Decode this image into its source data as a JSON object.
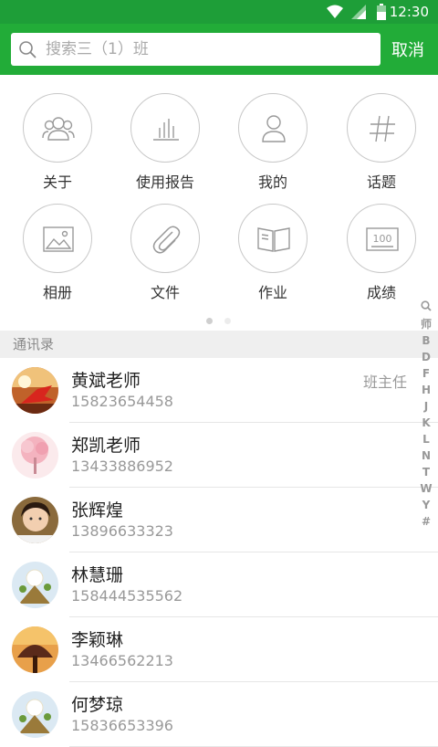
{
  "statusbar": {
    "time": "12:30"
  },
  "search": {
    "placeholder": "搜索三（1）班",
    "cancel_label": "取消"
  },
  "grid": {
    "items": [
      {
        "label": "关于",
        "icon": "group-icon"
      },
      {
        "label": "使用报告",
        "icon": "bar-chart-icon"
      },
      {
        "label": "我的",
        "icon": "person-icon"
      },
      {
        "label": "话题",
        "icon": "hash-icon"
      },
      {
        "label": "相册",
        "icon": "image-icon"
      },
      {
        "label": "文件",
        "icon": "paperclip-icon"
      },
      {
        "label": "作业",
        "icon": "book-icon"
      },
      {
        "label": "成绩",
        "icon": "score-board-icon"
      }
    ],
    "page_dots": {
      "count": 2,
      "active": 0
    }
  },
  "contacts": {
    "section_title": "通讯录",
    "items": [
      {
        "name": "黄斌老师",
        "phone": "15823654458",
        "role": "班主任",
        "avatar": "sunset-leaf"
      },
      {
        "name": "郑凯老师",
        "phone": "13433886952",
        "role": "",
        "avatar": "pink-tree"
      },
      {
        "name": "张辉煌",
        "phone": "13896633323",
        "role": "",
        "avatar": "child-photo"
      },
      {
        "name": "林慧珊",
        "phone": "158444535562",
        "role": "",
        "avatar": "dandelion"
      },
      {
        "name": "李颖琳",
        "phone": "13466562213",
        "role": "",
        "avatar": "tree-sunset"
      },
      {
        "name": "何梦琼",
        "phone": "15836653396",
        "role": "",
        "avatar": "dandelion"
      }
    ]
  },
  "index_bar": [
    "师",
    "B",
    "D",
    "F",
    "H",
    "J",
    "K",
    "L",
    "N",
    "T",
    "W",
    "Y",
    "#"
  ],
  "colors": {
    "brand_green": "#22ac38",
    "statusbar_green": "#1e9e38"
  }
}
